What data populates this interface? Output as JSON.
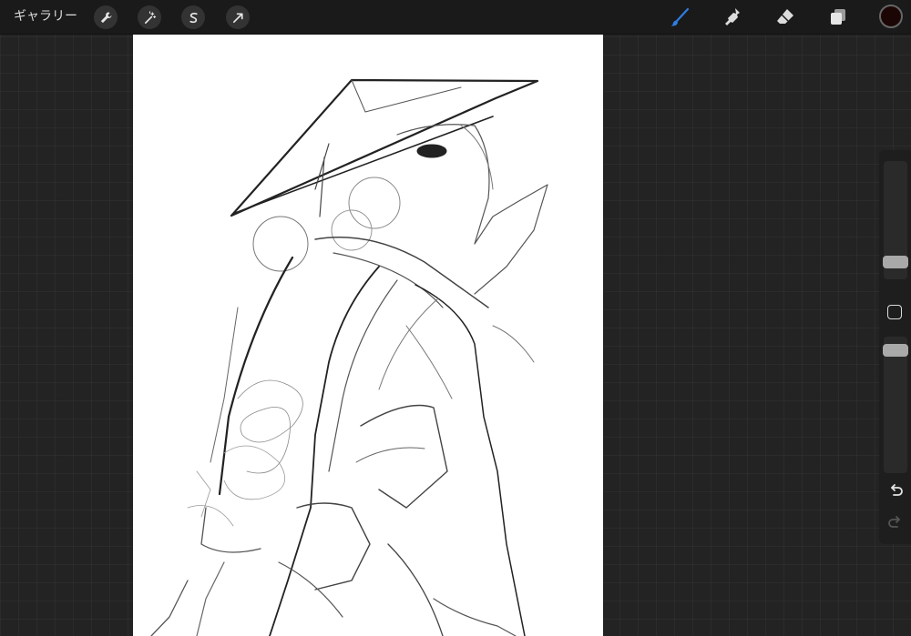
{
  "topbar": {
    "gallery_label": "ギャラリー",
    "left_tools": [
      "wrench-icon",
      "magic-wand-icon",
      "selection-icon",
      "transform-arrow-icon"
    ],
    "right_tools": [
      "brush-icon",
      "smudge-icon",
      "eraser-icon",
      "layers-icon"
    ],
    "active_tool": "brush-icon",
    "active_color": "#1b0505",
    "accent_color": "#2f7de1"
  },
  "sidebar": {
    "brush_size_level": 0.8,
    "opacity_level": 0.0,
    "controls": [
      "brush-size-slider",
      "modify-button",
      "opacity-slider",
      "undo-button",
      "redo-button"
    ]
  }
}
